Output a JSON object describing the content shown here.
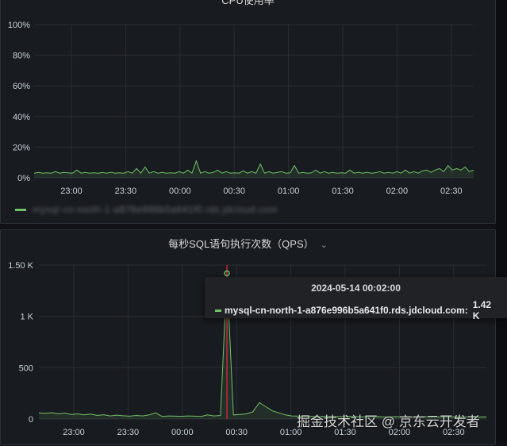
{
  "cpu_panel": {
    "title": "CPU使用率",
    "legend": {
      "series_label": "mysql-cn-north-1-a876e996b5a641f0.rds.jdcloud.com",
      "color": "#73bf69"
    },
    "chart_data": {
      "type": "line",
      "title": "CPU使用率",
      "x_ticks": [
        "23:00",
        "23:30",
        "00:00",
        "00:30",
        "01:00",
        "01:30",
        "02:00",
        "02:30"
      ],
      "y_ticks": [
        "100%",
        "80%",
        "60%",
        "40%",
        "20%",
        "0%"
      ],
      "ylim": [
        0,
        100
      ],
      "unit": "%",
      "grid": true,
      "series": [
        {
          "color": "#73bf69",
          "values": [
            3,
            3.5,
            3,
            3.2,
            3,
            4,
            3,
            3.5,
            3.2,
            3,
            5,
            3,
            3.5,
            3,
            3.2,
            3,
            3.4,
            3,
            3.6,
            3,
            3.2,
            3,
            4,
            3,
            6,
            3,
            7,
            3,
            4,
            3,
            3.5,
            3,
            3.2,
            3,
            4,
            3,
            5,
            3,
            11,
            3,
            4,
            3,
            3.5,
            5,
            3,
            4,
            3,
            3.2,
            3,
            4.5,
            3,
            4,
            3,
            9,
            3,
            4,
            3,
            3.5,
            4,
            3,
            3.2,
            8,
            3,
            3.5,
            3,
            3.2,
            5,
            3,
            4,
            3,
            3.5,
            3,
            3.2,
            3,
            5,
            3,
            3.5,
            3,
            3.6,
            3,
            3.2,
            4,
            3,
            3.5,
            3,
            4,
            3,
            5,
            3,
            4,
            3,
            4.5,
            5,
            3.5,
            5,
            6,
            4,
            8,
            5,
            6,
            5,
            7,
            4,
            5
          ]
        }
      ]
    }
  },
  "qps_panel": {
    "title": "每秒SQL语句执行次数（QPS）",
    "chart_data": {
      "type": "line",
      "title": "每秒SQL语句执行次数（QPS）",
      "x_ticks": [
        "23:00",
        "23:30",
        "00:00",
        "00:30",
        "01:00",
        "01:30",
        "02:00",
        "02:30"
      ],
      "y_ticks": [
        "1.50 K",
        "1 K",
        "500",
        "0"
      ],
      "ylim": [
        0,
        1500
      ],
      "grid": true,
      "series": [
        {
          "color": "#73bf69",
          "values": [
            60,
            55,
            62,
            50,
            58,
            45,
            50,
            40,
            48,
            35,
            42,
            30,
            38,
            32,
            28,
            35,
            30,
            40,
            60,
            25,
            30,
            28,
            26,
            30,
            28,
            25,
            40,
            30,
            35,
            1420,
            40,
            45,
            50,
            70,
            160,
            120,
            80,
            60,
            40,
            30,
            28,
            26,
            25,
            24,
            26,
            25,
            24,
            23,
            25,
            24,
            22,
            23,
            24,
            22,
            21,
            23,
            22,
            20,
            22,
            21,
            23,
            22,
            20,
            21,
            22,
            20,
            21,
            22,
            20,
            21
          ]
        }
      ],
      "marker_time": "2024-05-14 00:02:00"
    },
    "tooltip": {
      "time": "2024-05-14 00:02:00",
      "series": "mysql-cn-north-1-a876e996b5a641f0.rds.jdcloud.com:",
      "value": "1.42 K"
    }
  },
  "watermark": "掘金技术社区 @ 京东云开发者"
}
